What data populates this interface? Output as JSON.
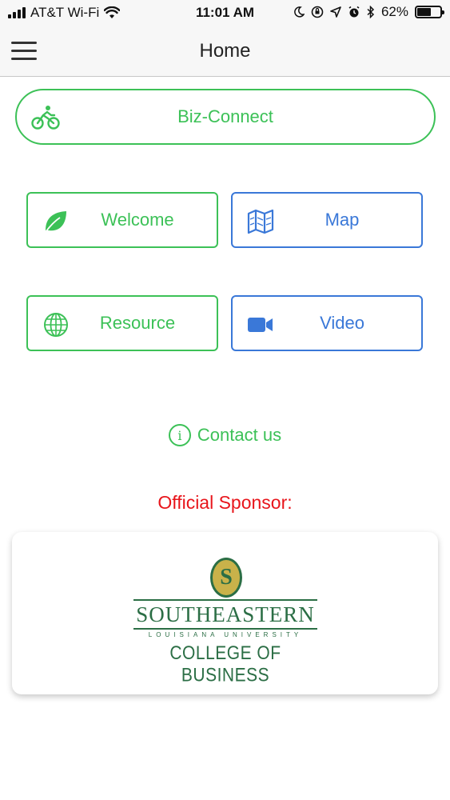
{
  "status_bar": {
    "carrier": "AT&T Wi-Fi",
    "time": "11:01 AM",
    "battery_percent": "62%",
    "battery_level": 0.62,
    "icons": [
      "signal-icon",
      "wifi-icon",
      "moon-icon",
      "orientation-lock-icon",
      "location-icon",
      "alarm-icon",
      "bluetooth-icon",
      "battery-icon"
    ]
  },
  "nav": {
    "title": "Home",
    "menu_icon": "hamburger-icon"
  },
  "buttons": {
    "biz_connect": {
      "label": "Biz-Connect",
      "icon": "bicycle-icon"
    },
    "welcome": {
      "label": "Welcome",
      "icon": "leaf-icon"
    },
    "map": {
      "label": "Map",
      "icon": "map-icon"
    },
    "resource": {
      "label": "Resource",
      "icon": "globe-icon"
    },
    "video": {
      "label": "Video",
      "icon": "video-camera-icon"
    }
  },
  "contact": {
    "label": "Contact us",
    "icon": "info-icon",
    "icon_glyph": "i"
  },
  "sponsor": {
    "label": "Official Sponsor:",
    "logo_initial": "S",
    "logo_name": "SOUTHEASTERN",
    "logo_subtitle": "LOUISIANA UNIVERSITY",
    "logo_college": "COLLEGE OF BUSINESS"
  },
  "colors": {
    "green": "#3cc157",
    "blue": "#3a78d8",
    "red": "#e8151b",
    "logo_green": "#2b6e45",
    "logo_gold": "#c9b24a"
  }
}
